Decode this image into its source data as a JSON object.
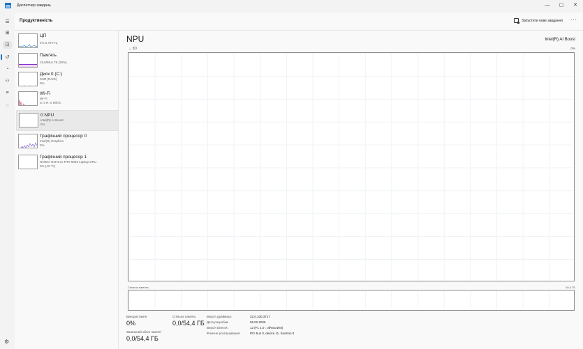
{
  "window": {
    "title": "Диспетчер завдань",
    "minimize_glyph": "—",
    "maximize_glyph": "▢",
    "close_glyph": "✕"
  },
  "nav_icons": [
    "menu-icon",
    "processes-icon",
    "performance-icon",
    "app-history-icon",
    "startup-apps-icon",
    "users-icon",
    "details-icon",
    "services-icon",
    "settings-icon"
  ],
  "header": {
    "title": "Продуктивність",
    "run_task_label": "Запустити нове завдання",
    "more_glyph": "···"
  },
  "devices": [
    {
      "name": "ЦП",
      "sub1": "4% 2,75 ГГц",
      "sub2": ""
    },
    {
      "name": "Пам'ять",
      "sub1": "19,5/95,6 ГБ (20%)",
      "sub2": ""
    },
    {
      "name": "Диск 0 (C:)",
      "sub1": "SSD (RAID)",
      "sub2": "0%"
    },
    {
      "name": "Wi-Fi",
      "sub1": "Wi-Fi",
      "sub2": "S: 0 R: 0 Кбіт/с"
    },
    {
      "name": "0 NPU",
      "sub1": "Intel(R) AI Boost",
      "sub2": "0%"
    },
    {
      "name": "Графічний процесор 0",
      "sub1": "Intel(R) Graphics",
      "sub2": "3%"
    },
    {
      "name": "Графічний процесор 1",
      "sub1": "NVIDIA GeForce RTX 5090 Laptop GPU",
      "sub2": "0% (43 °C)"
    }
  ],
  "npu": {
    "title": "NPU",
    "model": "Intel(R) AI Boost",
    "engine_label": "3D",
    "engine_pct": "0%",
    "shared_memory_label": "Спільна пам'ять",
    "shared_memory_max": "54,4 ГБ",
    "utilization_fraction": 0.0,
    "stats": {
      "utilization_label": "Використання",
      "utilization_value": "0%",
      "shared_label": "Спільна пам'ять",
      "shared_value": "0,0/54,4 ГБ",
      "total_label": "Загальний обсяг пам'яті",
      "total_value": "0,0/54,4 ГБ"
    },
    "info": [
      {
        "key": "Версія драйвера:",
        "value": "32.0.100.3717"
      },
      {
        "key": "Дата розробки:",
        "value": "06.02.2025"
      },
      {
        "key": "Версія DirectX:",
        "value": "12 (FL 1.0 : обчислити)"
      },
      {
        "key": "Фізичне розташування:",
        "value": "PCI bus 0, device 11, function 0"
      }
    ]
  },
  "colors": {
    "accent": "#1f6fc4",
    "cpu": "#1f78c8",
    "memory": "#8b2fc9",
    "disk": "#4f9b2e",
    "wifi": "#c24a7e",
    "gpu": "#7a4fc9"
  }
}
